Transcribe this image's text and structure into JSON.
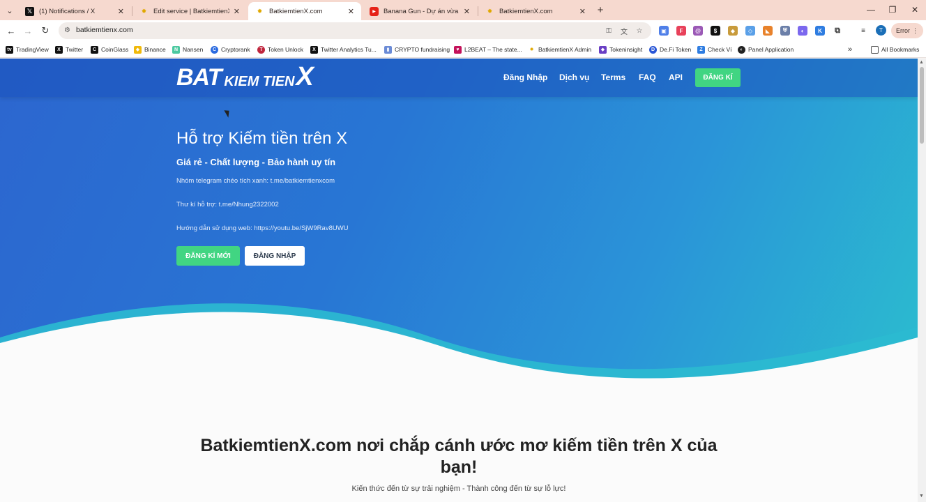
{
  "browser": {
    "tabs": [
      {
        "title": "(1) Notifications / X",
        "icon": "x-logo-icon"
      },
      {
        "title": "Edit service | BatkiemtienX.com",
        "icon": "sun-favicon-icon"
      },
      {
        "title": "BatkiemtienX.com",
        "icon": "sun-favicon-icon"
      },
      {
        "title": "Banana Gun - Dự án vừa listing",
        "icon": "youtube-icon"
      },
      {
        "title": "BatkiemtienX.com",
        "icon": "sun-favicon-icon"
      }
    ],
    "active_tab_index": 2,
    "url": "batkiemtienx.com",
    "profile_initial": "T",
    "error_label": "Error",
    "bookmarks": [
      {
        "label": "TradingView"
      },
      {
        "label": "Twitter"
      },
      {
        "label": "CoinGlass"
      },
      {
        "label": "Binance"
      },
      {
        "label": "Nansen"
      },
      {
        "label": "Cryptorank"
      },
      {
        "label": "Token Unlock"
      },
      {
        "label": "Twitter Analytics Tu..."
      },
      {
        "label": "CRYPTO fundraising"
      },
      {
        "label": "L2BEAT – The state..."
      },
      {
        "label": "BatkiemtienX Admin"
      },
      {
        "label": "Tokeninsight"
      },
      {
        "label": "De.Fi Token"
      },
      {
        "label": "Check Ví"
      },
      {
        "label": "Panel Application"
      }
    ],
    "all_bookmarks": "All Bookmarks"
  },
  "site": {
    "logo": {
      "part1": "BAT",
      "part2": "KIEM TIEN",
      "part3": "X"
    },
    "nav": {
      "login": "Đăng Nhập",
      "services": "Dịch vụ",
      "terms": "Terms",
      "faq": "FAQ",
      "api": "API",
      "signup": "ĐĂNG KÍ"
    },
    "hero": {
      "title": "Hỗ trợ Kiếm tiền trên X",
      "subtitle": "Giá rẻ - Chất lượng - Bảo hành uy tín",
      "line1": "Nhóm telegram chéo tích xanh: t.me/batkiemtienxcom",
      "line2": "Thư kí hỗ trợ: t.me/Nhung2322002",
      "line3": "Hướng dẫn sử dụng web: https://youtu.be/SjW9Rav8UWU",
      "btn_signup": "ĐĂNG KÍ MỚI",
      "btn_login": "ĐĂNG NHẬP"
    },
    "section": {
      "heading": "BatkiemtienX.com nơi chắp cánh ước mơ kiếm tiền trên X của bạn!",
      "subheading": "Kiến thức đến từ sự trải nghiệm - Thành công đến từ sự lỗ lực!"
    }
  },
  "colors": {
    "hero_start": "#2c66cf",
    "hero_end": "#2bbccf",
    "accent_green": "#41d582",
    "tabstrip": "#f6d9cf"
  }
}
